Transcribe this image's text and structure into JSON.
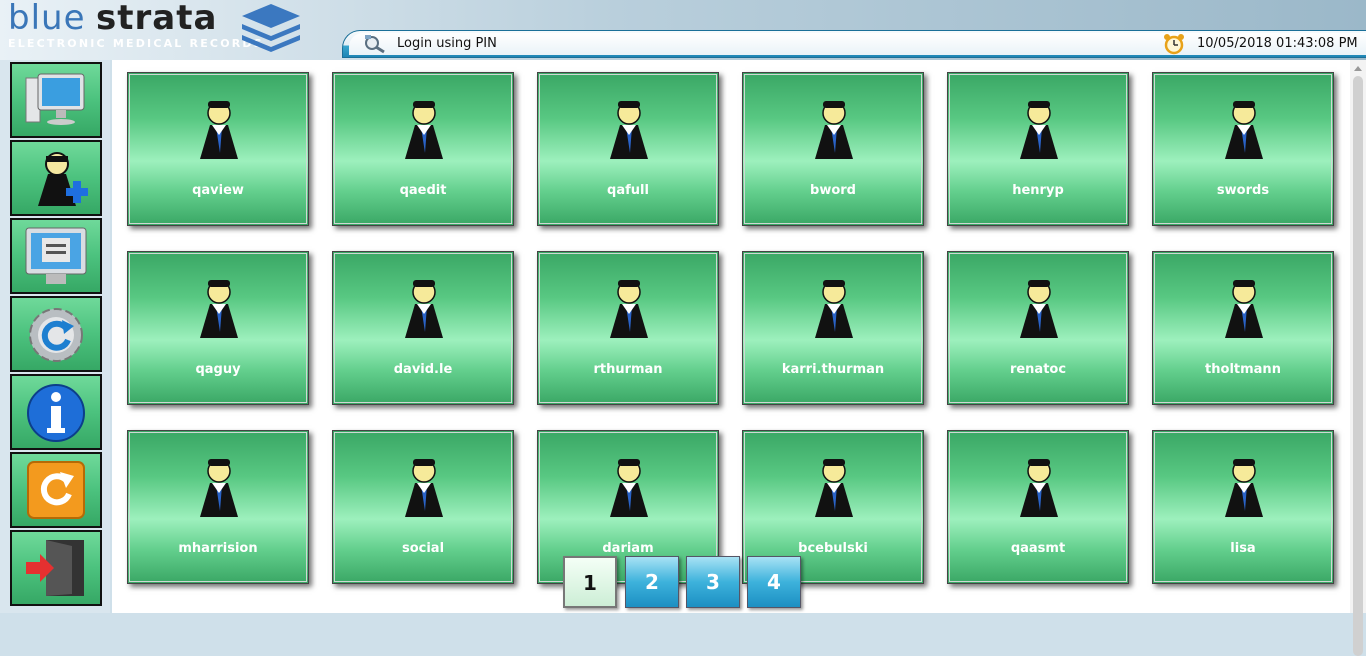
{
  "header": {
    "logo_blue": "blue",
    "logo_strata": "strata",
    "logo_subtitle": "ELECTRONIC MEDICAL RECORDS",
    "login_label": "Login using PIN",
    "datetime": "10/05/2018 01:43:08 PM"
  },
  "sidebar": {
    "items": [
      {
        "icon": "computer-monitor-icon"
      },
      {
        "icon": "add-user-icon"
      },
      {
        "icon": "screen-settings-icon"
      },
      {
        "icon": "refresh-gear-icon"
      },
      {
        "icon": "info-icon"
      },
      {
        "icon": "reload-icon"
      },
      {
        "icon": "exit-door-icon"
      }
    ]
  },
  "users": [
    {
      "name": "qaview"
    },
    {
      "name": "qaedit"
    },
    {
      "name": "qafull"
    },
    {
      "name": "bword"
    },
    {
      "name": "henryp"
    },
    {
      "name": "swords"
    },
    {
      "name": "qaguy"
    },
    {
      "name": "david.le"
    },
    {
      "name": "rthurman"
    },
    {
      "name": "karri.thurman"
    },
    {
      "name": "renatoc"
    },
    {
      "name": "tholtmann"
    },
    {
      "name": "mharrision"
    },
    {
      "name": "social"
    },
    {
      "name": "dariam"
    },
    {
      "name": "bcebulski"
    },
    {
      "name": "qaasmt"
    },
    {
      "name": "lisa"
    }
  ],
  "pagination": {
    "pages": [
      "1",
      "2",
      "3",
      "4"
    ],
    "current": "1"
  },
  "colors": {
    "tile_green": "#58c882",
    "header_blue": "#1e85b4",
    "page_blue": "#3db2dc"
  }
}
